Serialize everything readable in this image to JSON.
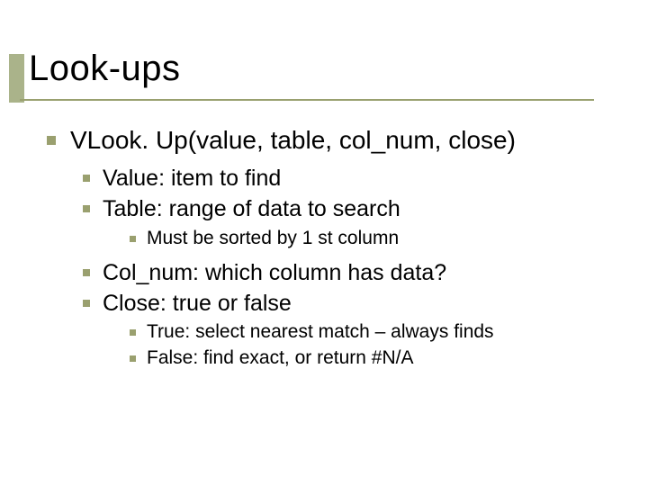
{
  "title": "Look-ups",
  "l1": "VLook. Up(value, table, col_num, close)",
  "l2a": "Value: item to find",
  "l2b": "Table: range of data to search",
  "l3a": "Must be sorted by 1 st column",
  "l2c": "Col_num: which column has data?",
  "l2d": "Close: true or false",
  "l3b": "True: select nearest match – always finds",
  "l3c": "False: find exact, or return #N/A"
}
